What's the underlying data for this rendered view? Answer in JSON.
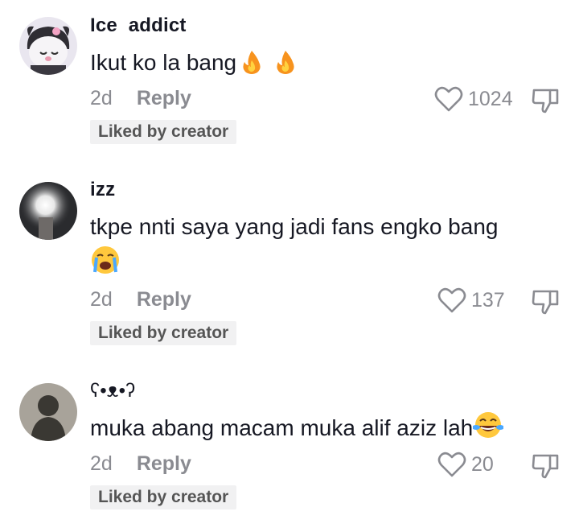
{
  "comments": [
    {
      "username": "Ice  addict",
      "text": "Ikut ko la bang",
      "emojis": [
        "fire-emoji",
        "fire-emoji"
      ],
      "time": "2d",
      "reply_label": "Reply",
      "likes": "1024",
      "badge": "Liked by creator"
    },
    {
      "username": "izz",
      "text": "tkpe nnti saya yang jadi fans engko bang",
      "emojis": [
        "loudly-crying-face-emoji"
      ],
      "time": "2d",
      "reply_label": "Reply",
      "likes": "137",
      "badge": "Liked by creator"
    },
    {
      "username": "ʕ•ᴥ•ʔ",
      "text": "muka abang macam muka alif aziz lah",
      "emojis": [
        "face-with-tears-of-joy-emoji"
      ],
      "time": "2d",
      "reply_label": "Reply",
      "likes": "20",
      "badge": "Liked by creator"
    }
  ],
  "colors": {
    "text": "#161823",
    "muted": "#8a8b91",
    "badge_bg": "#f1f1f2"
  }
}
